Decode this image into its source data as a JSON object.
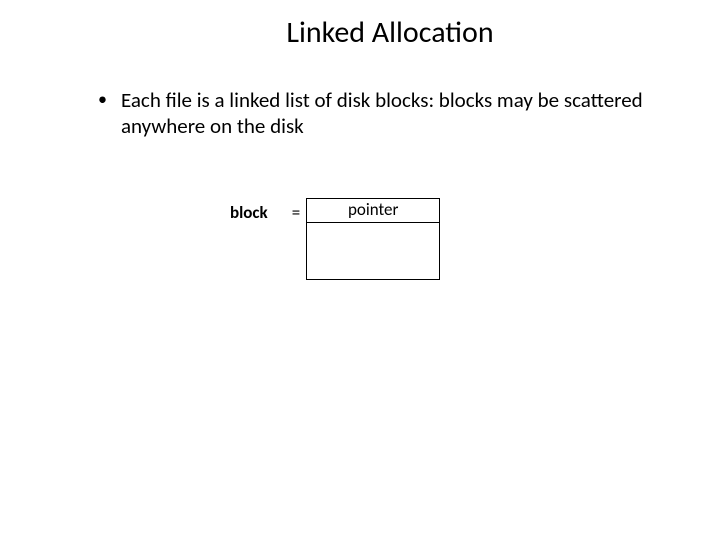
{
  "title": "Linked Allocation",
  "bullet": {
    "marker": "•",
    "text": "Each file is a linked list of disk blocks: blocks may be scattered anywhere on the disk"
  },
  "diagram": {
    "block_label": "block",
    "equals": "=",
    "pointer_label": "pointer"
  }
}
